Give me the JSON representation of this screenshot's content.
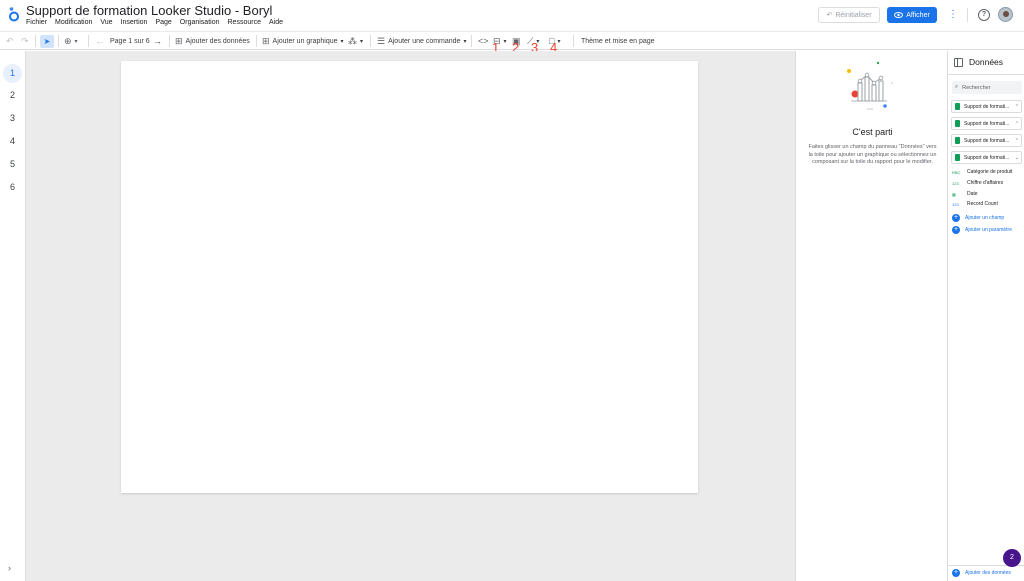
{
  "header": {
    "title": "Support de formation Looker Studio - Boryl",
    "menu": [
      "Fichier",
      "Modification",
      "Vue",
      "Insertion",
      "Page",
      "Organisation",
      "Ressource",
      "Aide"
    ],
    "reset_label": "Réinitialiser",
    "view_label": "Afficher"
  },
  "toolbar": {
    "page_indicator": "Page 1 sur 6",
    "add_data_label": "Ajouter des données",
    "add_chart_label": "Ajouter un graphique",
    "add_control_label": "Ajouter une commande",
    "theme_label": "Thème et mise en page",
    "annotations": [
      "1",
      "2",
      "3",
      "4"
    ]
  },
  "pages": [
    "1",
    "2",
    "3",
    "4",
    "5",
    "6"
  ],
  "properties": {
    "title": "C'est parti",
    "description": "Faites glisser un champ du panneau \"Données\" vers la toile pour ajouter un graphique ou sélectionnez un composant sur la toile du rapport pour le modifier."
  },
  "data_panel": {
    "title": "Données",
    "search_placeholder": "Rechercher",
    "sources": [
      "Support de formati...",
      "Support de formati...",
      "Support de formati...",
      "Support de formati..."
    ],
    "fields": [
      {
        "type": "RBC",
        "name": "Catégorie de produit"
      },
      {
        "type": "123",
        "name": "Chiffre d'affaires"
      },
      {
        "type": "cal",
        "name": "Date"
      },
      {
        "type": "123",
        "name": "Record Count"
      }
    ],
    "add_field_label": "Ajouter un champ",
    "add_param_label": "Ajouter un paramètre",
    "add_data_label": "Ajouter des données"
  },
  "badge": "2",
  "colors": {
    "accent": "#1a73e8",
    "annotation": "#ea4335",
    "sheets": "#0f9d58",
    "badge": "#4a148c"
  }
}
